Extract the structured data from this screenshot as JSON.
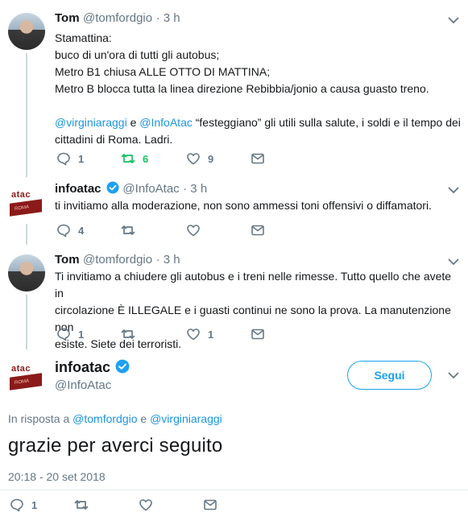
{
  "tweets": [
    {
      "name": "Tom",
      "handle": "@tomfordgio",
      "time": "· 3 h",
      "lines": [
        "Stamattina:",
        "buco di un'ora di tutti gli autobus;",
        "Metro B1 chiusa ALLE OTTO DI MATTINA;",
        "Metro B blocca tutta la linea direzione Rebibbia/jonio a causa guasto treno."
      ],
      "mention1": "@virginiaraggi",
      "conj": " e ",
      "mention2": "@InfoAtac",
      "rest1": " “festeggiano” gli utili sulla salute, i soldi e il tempo dei",
      "rest2": "cittadini di Roma. Ladri.",
      "reply_count": "1",
      "retweet_count": "6",
      "like_count": "9"
    },
    {
      "name": "infoatac",
      "handle": "@InfoAtac",
      "time": "· 3 h",
      "lines": [
        "ti invitiamo alla moderazione, non sono ammessi toni offensivi o diffamatori."
      ],
      "reply_count": "4"
    },
    {
      "name": "Tom",
      "handle": "@tomfordgio",
      "time": "· 3 h",
      "lines": [
        "Ti invitiamo a chiudere gli autobus e i treni nelle rimesse. Tutto quello che avete in",
        "circolazione È ILLEGALE e i guasti continui ne sono la prova. La manutenzione non",
        "esiste. Siete dei terroristi."
      ],
      "reply_count": "1",
      "like_count": "1"
    }
  ],
  "main_tweet": {
    "name": "infoatac",
    "handle": "@InfoAtac",
    "follow_label": "Segui",
    "reply_prefix": "In risposta a ",
    "reply_user1": "@tomfordgio",
    "reply_conj": " e ",
    "reply_user2": "@virginiaraggi",
    "text": "grazie per averci seguito",
    "timestamp": "20:18 - 20 set 2018",
    "reply_count": "1"
  },
  "avatar_logo": {
    "brand": "atac",
    "city": "ROMA"
  },
  "colors": {
    "link": "#1b95e0",
    "retweet_active": "#17bf63",
    "muted": "#657786",
    "verified": "#1da1f2"
  },
  "icons": [
    "reply-icon",
    "retweet-icon",
    "like-icon",
    "dm-icon",
    "verified-icon",
    "chevron-down-icon"
  ]
}
